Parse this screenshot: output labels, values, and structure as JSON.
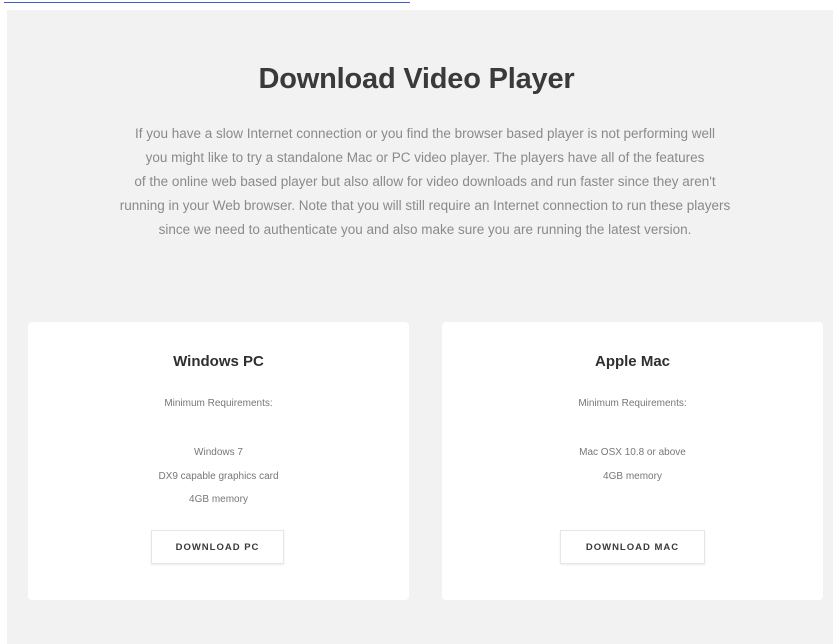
{
  "header": {
    "title": "Download Video Player"
  },
  "intro": {
    "lines": [
      "If you have a slow Internet connection or you find the browser based player is not performing well",
      "you might like to try a standalone Mac or PC video player. The players have all of the features",
      "of the online web based player but also allow for video downloads and run faster since they aren't",
      "running in your Web browser. Note that you will still require an Internet connection to run these players",
      "since we need to authenticate you and also make sure you are running the latest version."
    ]
  },
  "cards": [
    {
      "title": "Windows PC",
      "subtitle": "Minimum Requirements:",
      "requirements": [
        "Windows 7",
        "DX9 capable graphics card",
        "4GB memory"
      ],
      "button_label": "DOWNLOAD PC"
    },
    {
      "title": "Apple Mac",
      "subtitle": "Minimum Requirements:",
      "requirements": [
        "Mac OSX 10.8 or above",
        "4GB memory"
      ],
      "button_label": "DOWNLOAD MAC"
    }
  ],
  "colors": {
    "panel_background": "#f2f2f2",
    "card_background": "#ffffff",
    "link": "#3b5fc4"
  }
}
